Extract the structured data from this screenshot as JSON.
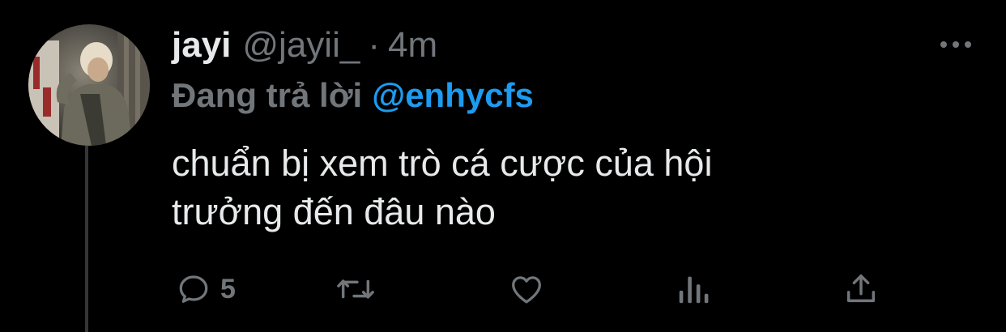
{
  "colors": {
    "background": "#000000",
    "text_primary": "#e7e9ea",
    "text_secondary": "#71767b",
    "accent": "#1d9bf0",
    "thread_line": "#333639"
  },
  "tweet": {
    "author": {
      "display_name": "jayi",
      "handle": "@jayii_",
      "avatar_icon": "profile-photo"
    },
    "separator": "·",
    "timestamp": "4m",
    "replying_to": {
      "prefix": "Đang trả lời",
      "mention": "@enhycfs"
    },
    "text_lines": [
      "chuẩn bị xem trò cá cược của hội",
      "trưởng đến đâu nào"
    ],
    "actions": {
      "reply": {
        "icon": "speech-bubble-icon",
        "count": "5"
      },
      "retweet": {
        "icon": "retweet-icon",
        "count": ""
      },
      "like": {
        "icon": "heart-icon",
        "count": ""
      },
      "analytics": {
        "icon": "bar-chart-icon"
      },
      "share": {
        "icon": "share-upload-icon"
      }
    },
    "more_icon": "ellipsis-icon"
  }
}
